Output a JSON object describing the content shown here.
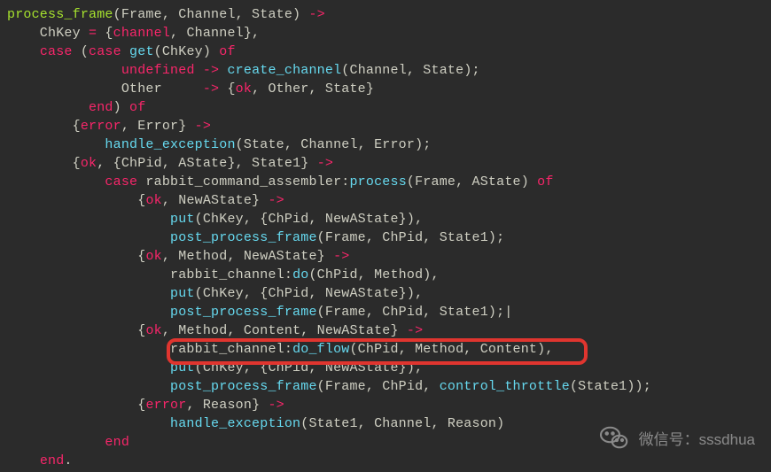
{
  "code": {
    "l01a": "process_frame",
    "l01b": "(Frame, Channel, State) ",
    "l01c": "->",
    "l02a": "    ChKey ",
    "l02b": "=",
    "l02c": " {",
    "l02d": "channel",
    "l02e": ", Channel},",
    "l03a": "    ",
    "l03b": "case",
    "l03c": " (",
    "l03d": "case",
    "l03e": " ",
    "l03f": "get",
    "l03g": "(ChKey) ",
    "l03h": "of",
    "l04a": "              ",
    "l04b": "undefined",
    "l04c": " ",
    "l04d": "->",
    "l04e": " ",
    "l04f": "create_channel",
    "l04g": "(Channel, State);",
    "l05a": "              Other     ",
    "l05b": "->",
    "l05c": " {",
    "l05d": "ok",
    "l05e": ", Other, State}",
    "l06a": "          ",
    "l06b": "end",
    "l06c": ") ",
    "l06d": "of",
    "l07a": "        {",
    "l07b": "error",
    "l07c": ", Error} ",
    "l07d": "->",
    "l08a": "            ",
    "l08b": "handle_exception",
    "l08c": "(State, Channel, Error);",
    "l09a": "        {",
    "l09b": "ok",
    "l09c": ", {ChPid, AState}, State1} ",
    "l09d": "->",
    "l10a": "            ",
    "l10b": "case",
    "l10c": " rabbit_command_assembler:",
    "l10d": "process",
    "l10e": "(Frame, AState) ",
    "l10f": "of",
    "l11a": "                {",
    "l11b": "ok",
    "l11c": ", NewAState} ",
    "l11d": "->",
    "l12a": "                    ",
    "l12b": "put",
    "l12c": "(ChKey, {ChPid, NewAState}),",
    "l13a": "                    ",
    "l13b": "post_process_frame",
    "l13c": "(Frame, ChPid, State1);",
    "l14a": "                {",
    "l14b": "ok",
    "l14c": ", Method, NewAState} ",
    "l14d": "->",
    "l15a": "                    rabbit_channel:",
    "l15b": "do",
    "l15c": "(ChPid, Method),",
    "l16a": "                    ",
    "l16b": "put",
    "l16c": "(ChKey, {ChPid, NewAState}),",
    "l17a": "                    ",
    "l17b": "post_process_frame",
    "l17c": "(Frame, ChPid, State1);|",
    "l18a": "                {",
    "l18b": "ok",
    "l18c": ", Method, Content, NewAState} ",
    "l18d": "->",
    "l19a": "                    rabbit_channel:",
    "l19b": "do_flow",
    "l19c": "(ChPid, Method, Content),",
    "l20a": "                    ",
    "l20b": "put",
    "l20c": "(ChKey, {ChPid, NewAState}),",
    "l21a": "                    ",
    "l21b": "post_process_frame",
    "l21c": "(Frame, ChPid, ",
    "l21d": "control_throttle",
    "l21e": "(State1));",
    "l22a": "                {",
    "l22b": "error",
    "l22c": ", Reason} ",
    "l22d": "->",
    "l23a": "                    ",
    "l23b": "handle_exception",
    "l23c": "(State1, Channel, Reason)",
    "l24a": "            ",
    "l24b": "end",
    "l25a": "    ",
    "l25b": "end",
    "l25c": "."
  },
  "watermark": {
    "text": "微信号：sssdhua"
  }
}
